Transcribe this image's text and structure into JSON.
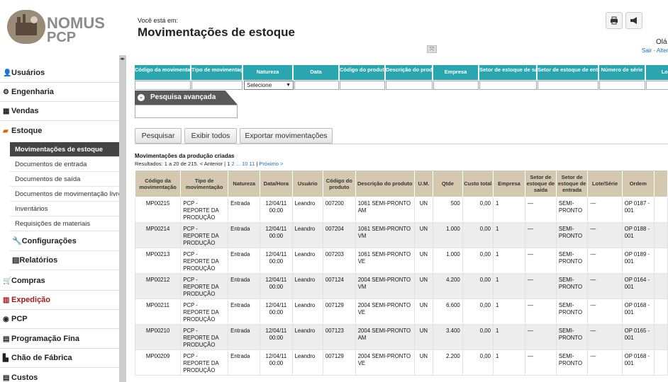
{
  "header": {
    "logo_line1": "NOMUS",
    "logo_line2": "PCP",
    "where_label": "Você está em:",
    "page_title": "Movimentações de estoque",
    "greeting": "Olá",
    "links": "Sair - Alter",
    "print_icon": "printer-icon",
    "announce_icon": "megaphone-icon"
  },
  "sidebar": {
    "items": [
      {
        "label": "Usuários",
        "icon": "user-icon"
      },
      {
        "label": "Engenharia",
        "icon": "gear-icon"
      },
      {
        "label": "Vendas",
        "icon": "grid-icon"
      },
      {
        "label": "Estoque",
        "icon": "folder-icon"
      },
      {
        "label": "Compras",
        "icon": "cart-icon"
      },
      {
        "label": "Expedição",
        "icon": "barcode-icon"
      },
      {
        "label": "PCP",
        "icon": "globe-icon"
      },
      {
        "label": "Programação Fina",
        "icon": "list-icon"
      },
      {
        "label": "Chão de Fábrica",
        "icon": "factory-icon"
      },
      {
        "label": "Custos",
        "icon": "list-icon"
      }
    ],
    "estoque_sub": [
      "Movimentações de estoque",
      "Documentos de entrada",
      "Documentos de saída",
      "Documentos de movimentação livre",
      "Inventários",
      "Requisições de materiais"
    ],
    "estoque_sub2": [
      {
        "label": "Configurações",
        "icon": "wrench-icon"
      },
      {
        "label": "Relatórios",
        "icon": "report-icon"
      }
    ]
  },
  "filter": {
    "columns": [
      "Código da movimentação",
      "Tipo de movimentação",
      "Natureza",
      "Data",
      "Código do produto",
      "Descrição do produto",
      "Empresa",
      "Setor de estoque de saída",
      "Setor de estoque de entrada",
      "Número de série",
      "Lote"
    ],
    "natureza_select": "Selecione"
  },
  "advanced_search": "Pesquisa avançada",
  "buttons": {
    "search": "Pesquisar",
    "show_all": "Exibir todos",
    "export": "Exportar movimentações"
  },
  "section_title": "Movimentações da produção criadas",
  "results": {
    "prefix": "Resultados: 1 a 20 de 215. < Anterior |",
    "pages": "1",
    "pages_link": "2 ... 10 11",
    "next": "Próximo >"
  },
  "table": {
    "headers": [
      "Código da movimentação",
      "Tipo de movimentação",
      "Natureza",
      "Data/Hora",
      "Usuário",
      "Código do produto",
      "Descrição do produto",
      "U.M.",
      "Qtde",
      "Custo total",
      "Empresa",
      "Setor de estoque de saída",
      "Setor de estoque de entrada",
      "Lote/Série",
      "Ordem",
      ""
    ],
    "rows": [
      [
        "MP00215",
        "PCP - REPORTE DA PRODUÇÃO",
        "Entrada",
        "12/04/11 00:00",
        "Leandro",
        "007200",
        "1061 SEMI-PRONTO AM",
        "UN",
        "500",
        "0,00",
        "1",
        "—",
        "SEMI-PRONTO",
        "—",
        "OP 0187 - 001",
        ""
      ],
      [
        "MP00214",
        "PCP - REPORTE DA PRODUÇÃO",
        "Entrada",
        "12/04/11 00:00",
        "Leandro",
        "007204",
        "1061 SEMI-PRONTO VM",
        "UN",
        "1.000",
        "0,00",
        "1",
        "—",
        "SEMI-PRONTO",
        "—",
        "OP 0188 - 001",
        ""
      ],
      [
        "MP00213",
        "PCP - REPORTE DA PRODUÇÃO",
        "Entrada",
        "12/04/11 00:00",
        "Leandro",
        "007203",
        "1061 SEMI-PRONTO VE",
        "UN",
        "1.000",
        "0,00",
        "1",
        "—",
        "SEMI-PRONTO",
        "—",
        "OP 0189 - 001",
        ""
      ],
      [
        "MP00212",
        "PCP - REPORTE DA PRODUÇÃO",
        "Entrada",
        "12/04/11 00:00",
        "Leandro",
        "007124",
        "2004 SEMI-PRONTO VM",
        "UN",
        "4.200",
        "0,00",
        "1",
        "—",
        "SEMI-PRONTO",
        "—",
        "OP 0164 - 001",
        ""
      ],
      [
        "MP00211",
        "PCP - REPORTE DA PRODUÇÃO",
        "Entrada",
        "12/04/11 00:00",
        "Leandro",
        "007129",
        "2004 SEMI-PRONTO VE",
        "UN",
        "6.600",
        "0,00",
        "1",
        "—",
        "SEMI-PRONTO",
        "—",
        "OP 0168 - 001",
        ""
      ],
      [
        "MP00210",
        "PCP - REPORTE DA PRODUÇÃO",
        "Entrada",
        "12/04/11 00:00",
        "Leandro",
        "007123",
        "2004 SEMI-PRONTO AM",
        "UN",
        "3.400",
        "0,00",
        "1",
        "—",
        "SEMI-PRONTO",
        "—",
        "OP 0165 - 001",
        ""
      ],
      [
        "MP00209",
        "PCP - REPORTE DA PRODUÇÃO",
        "Entrada",
        "12/04/11 00:00",
        "Leandro",
        "007129",
        "2004 SEMI-PRONTO VE",
        "UN",
        "2.200",
        "0,00",
        "1",
        "—",
        "SEMI-PRONTO",
        "—",
        "OP 0168 - 001",
        ""
      ]
    ]
  }
}
